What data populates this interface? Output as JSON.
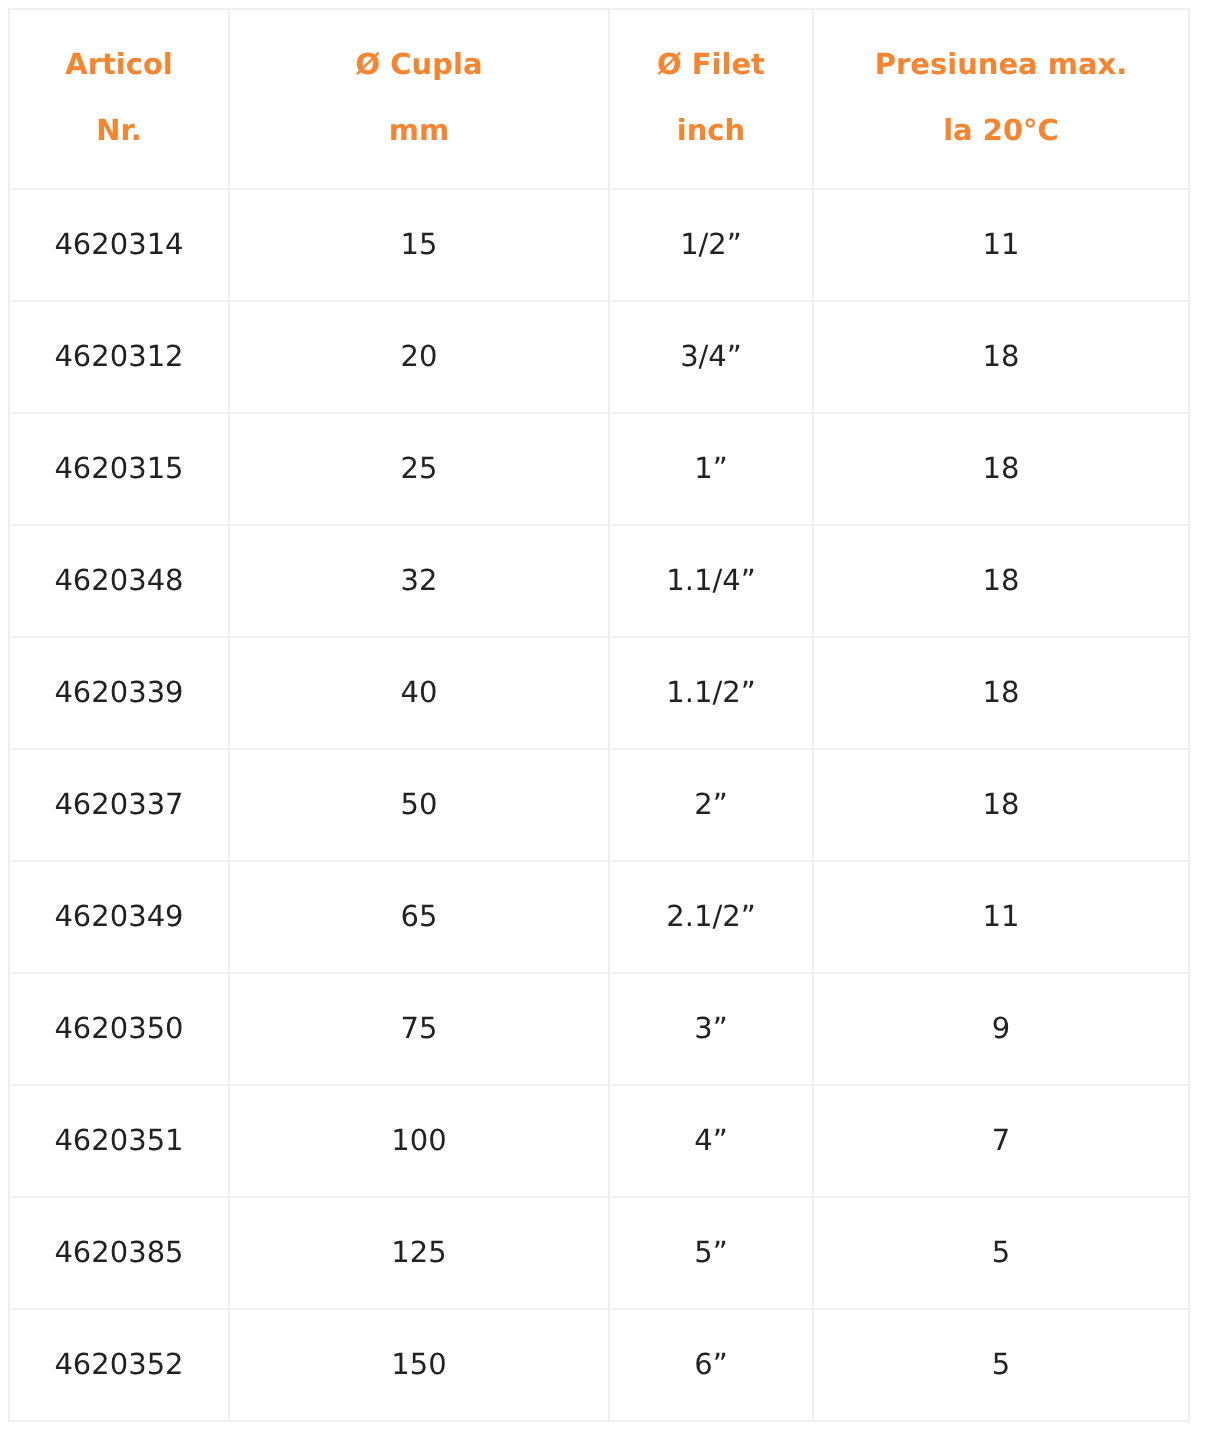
{
  "table": {
    "columns": [
      {
        "lines": [
          "Articol",
          "Nr."
        ]
      },
      {
        "lines": [
          "Ø Cupla",
          "mm"
        ]
      },
      {
        "lines": [
          "Ø Filet",
          "inch"
        ]
      },
      {
        "lines": [
          "Presiunea max.",
          "la 20°C"
        ]
      }
    ],
    "rows": [
      [
        "4620314",
        "15",
        "1/2”",
        "11"
      ],
      [
        "4620312",
        "20",
        "3/4”",
        "18"
      ],
      [
        "4620315",
        "25",
        "1”",
        "18"
      ],
      [
        "4620348",
        "32",
        "1.1/4”",
        "18"
      ],
      [
        "4620339",
        "40",
        "1.1/2”",
        "18"
      ],
      [
        "4620337",
        "50",
        "2”",
        "18"
      ],
      [
        "4620349",
        "65",
        "2.1/2”",
        "11"
      ],
      [
        "4620350",
        "75",
        "3”",
        "9"
      ],
      [
        "4620351",
        "100",
        "4”",
        "7"
      ],
      [
        "4620385",
        "125",
        "5”",
        "5"
      ],
      [
        "4620352",
        "150",
        "6”",
        "5"
      ]
    ]
  }
}
